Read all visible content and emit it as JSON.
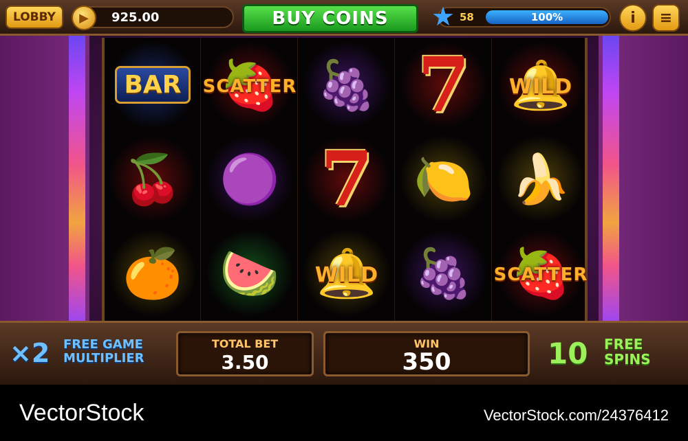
{
  "topbar": {
    "lobby_label": "LOBBY",
    "balance": "925.00",
    "buy_label": "BUY COINS",
    "level": "58",
    "xp_percent": "100%",
    "xp_fraction": 1.0,
    "info_label": "i",
    "menu_label": "≡"
  },
  "reels": {
    "r1": [
      {
        "type": "bar",
        "label": "BAR"
      },
      {
        "type": "cherry",
        "glyph": "🍒"
      },
      {
        "type": "orange",
        "glyph": "🍊"
      }
    ],
    "r2": [
      {
        "type": "scatter",
        "label": "SCATTER",
        "glyph": "🍓"
      },
      {
        "type": "plum",
        "glyph": "🟣"
      },
      {
        "type": "watermelon",
        "glyph": "🍉"
      }
    ],
    "r3": [
      {
        "type": "grapes",
        "glyph": "🍇"
      },
      {
        "type": "seven",
        "label": "7"
      },
      {
        "type": "wild",
        "label": "WILD",
        "glyph": "🔔"
      }
    ],
    "r4": [
      {
        "type": "seven",
        "label": "7"
      },
      {
        "type": "lemon",
        "glyph": "🍋"
      },
      {
        "type": "grapes",
        "glyph": "🍇"
      }
    ],
    "r5": [
      {
        "type": "wild",
        "label": "WILD",
        "glyph": "🔔"
      },
      {
        "type": "banana",
        "glyph": "🍌"
      },
      {
        "type": "scatter",
        "label": "SCATTER",
        "glyph": "🍓"
      }
    ]
  },
  "bottom": {
    "multiplier": "×2",
    "multiplier_label": "FREE GAME MULTIPLIER",
    "total_bet_label": "TOTAL BET",
    "total_bet": "3.50",
    "win_label": "WIN",
    "win": "350",
    "free_spins": "10",
    "free_spins_label": "FREE SPINS"
  },
  "footer": {
    "brand": "VectorStock",
    "url": "VectorStock.com/24376412"
  },
  "colors": {
    "buy_button": "#2bb52a",
    "xp_bar": "#1e7fe0",
    "gold": "#f2a41c"
  }
}
